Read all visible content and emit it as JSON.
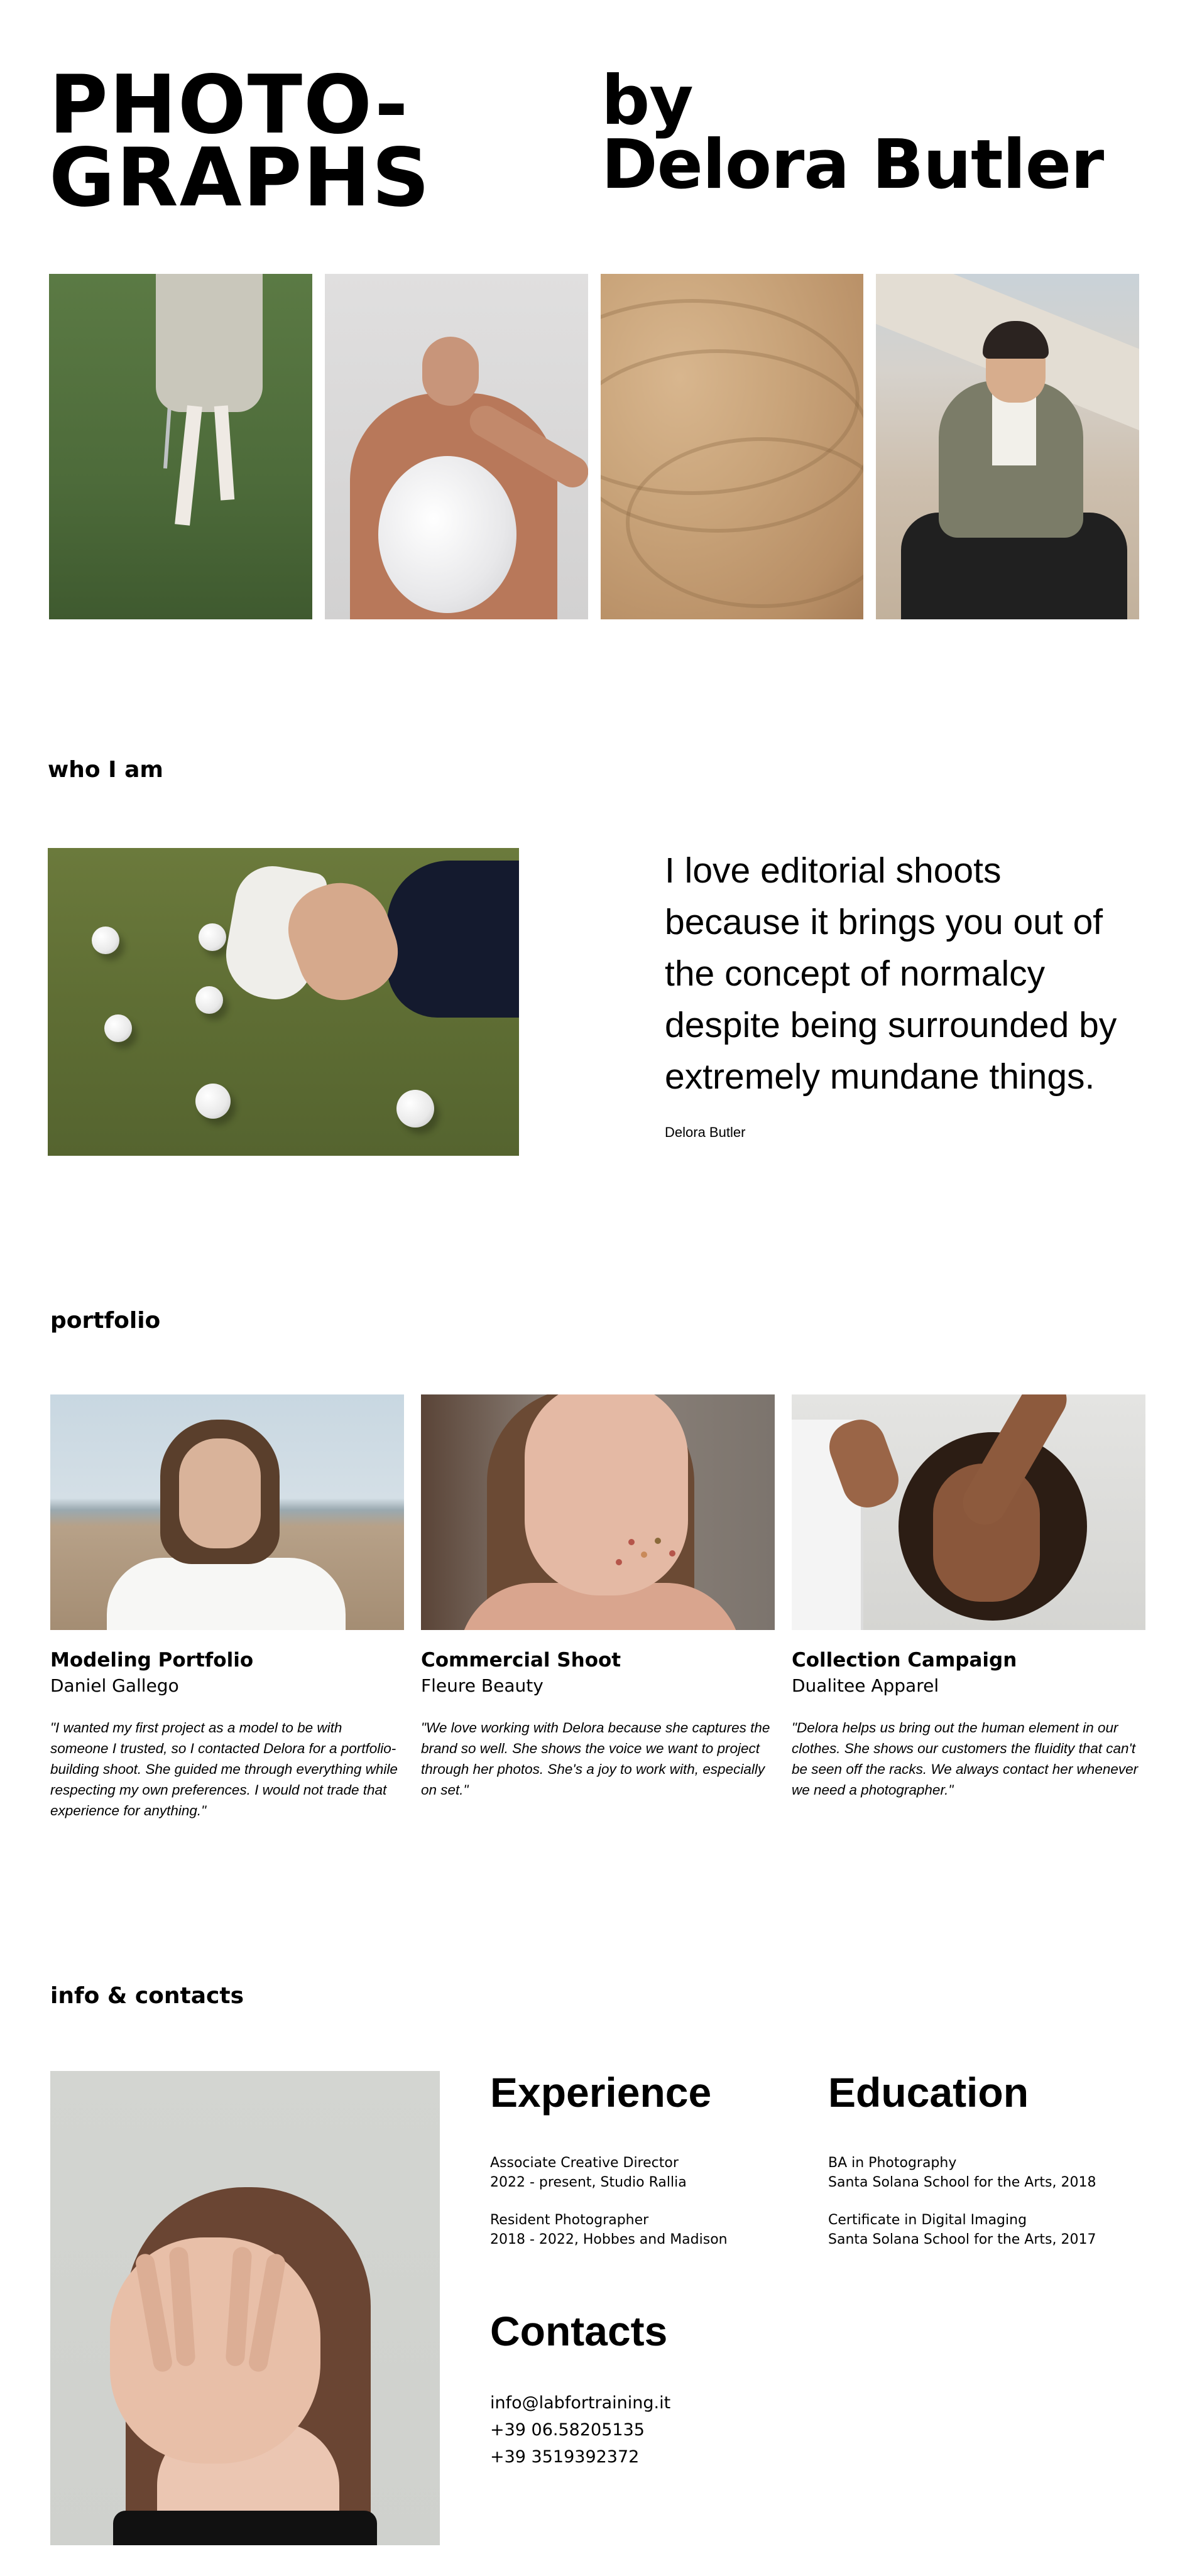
{
  "hero": {
    "title_line1": "PHOTO-",
    "title_line2": "GRAPHS",
    "by_line1": "by",
    "by_line2": "Delora Butler"
  },
  "about": {
    "heading": "who I am",
    "quote": "I love editorial shoots because it brings you out of the concept of normalcy despite being surrounded by extremely mundane things.",
    "author": "Delora Butler"
  },
  "portfolio": {
    "heading": "portfolio",
    "items": [
      {
        "title": "Modeling Portfolio",
        "client": "Daniel Gallego",
        "quote": "\"I wanted my first project as a model to be with someone I trusted, so I contacted Delora for a portfolio-building shoot. She guided me through everything while respecting my own preferences. I would not trade that experience for anything.\""
      },
      {
        "title": "Commercial Shoot",
        "client": "Fleure Beauty",
        "quote": "\"We love working with Delora because she captures the brand so well. She shows the voice we want to project through her photos. She's a joy to work with, especially on set.\""
      },
      {
        "title": "Collection Campaign",
        "client": "Dualitee Apparel",
        "quote": "\"Delora helps us bring out the human element in our clothes. She shows our customers the fluidity that can't be seen off the racks. We always contact her whenever we need a photographer.\""
      }
    ]
  },
  "info": {
    "heading": "info & contacts",
    "experience": {
      "heading": "Experience",
      "entries": [
        {
          "role": "Associate Creative Director",
          "detail": "2022 - present, Studio Rallia"
        },
        {
          "role": "Resident Photographer",
          "detail": "2018 - 2022, Hobbes and Madison"
        }
      ]
    },
    "education": {
      "heading": "Education",
      "entries": [
        {
          "role": "BA in Photography",
          "detail": "Santa Solana School for the Arts, 2018"
        },
        {
          "role": "Certificate in Digital Imaging",
          "detail": "Santa Solana School for the Arts, 2017"
        }
      ]
    },
    "contacts": {
      "heading": "Contacts",
      "email": "info@labfortraining.it",
      "phone1": "+39 06.58205135",
      "phone2": "+39 3519392372"
    }
  }
}
